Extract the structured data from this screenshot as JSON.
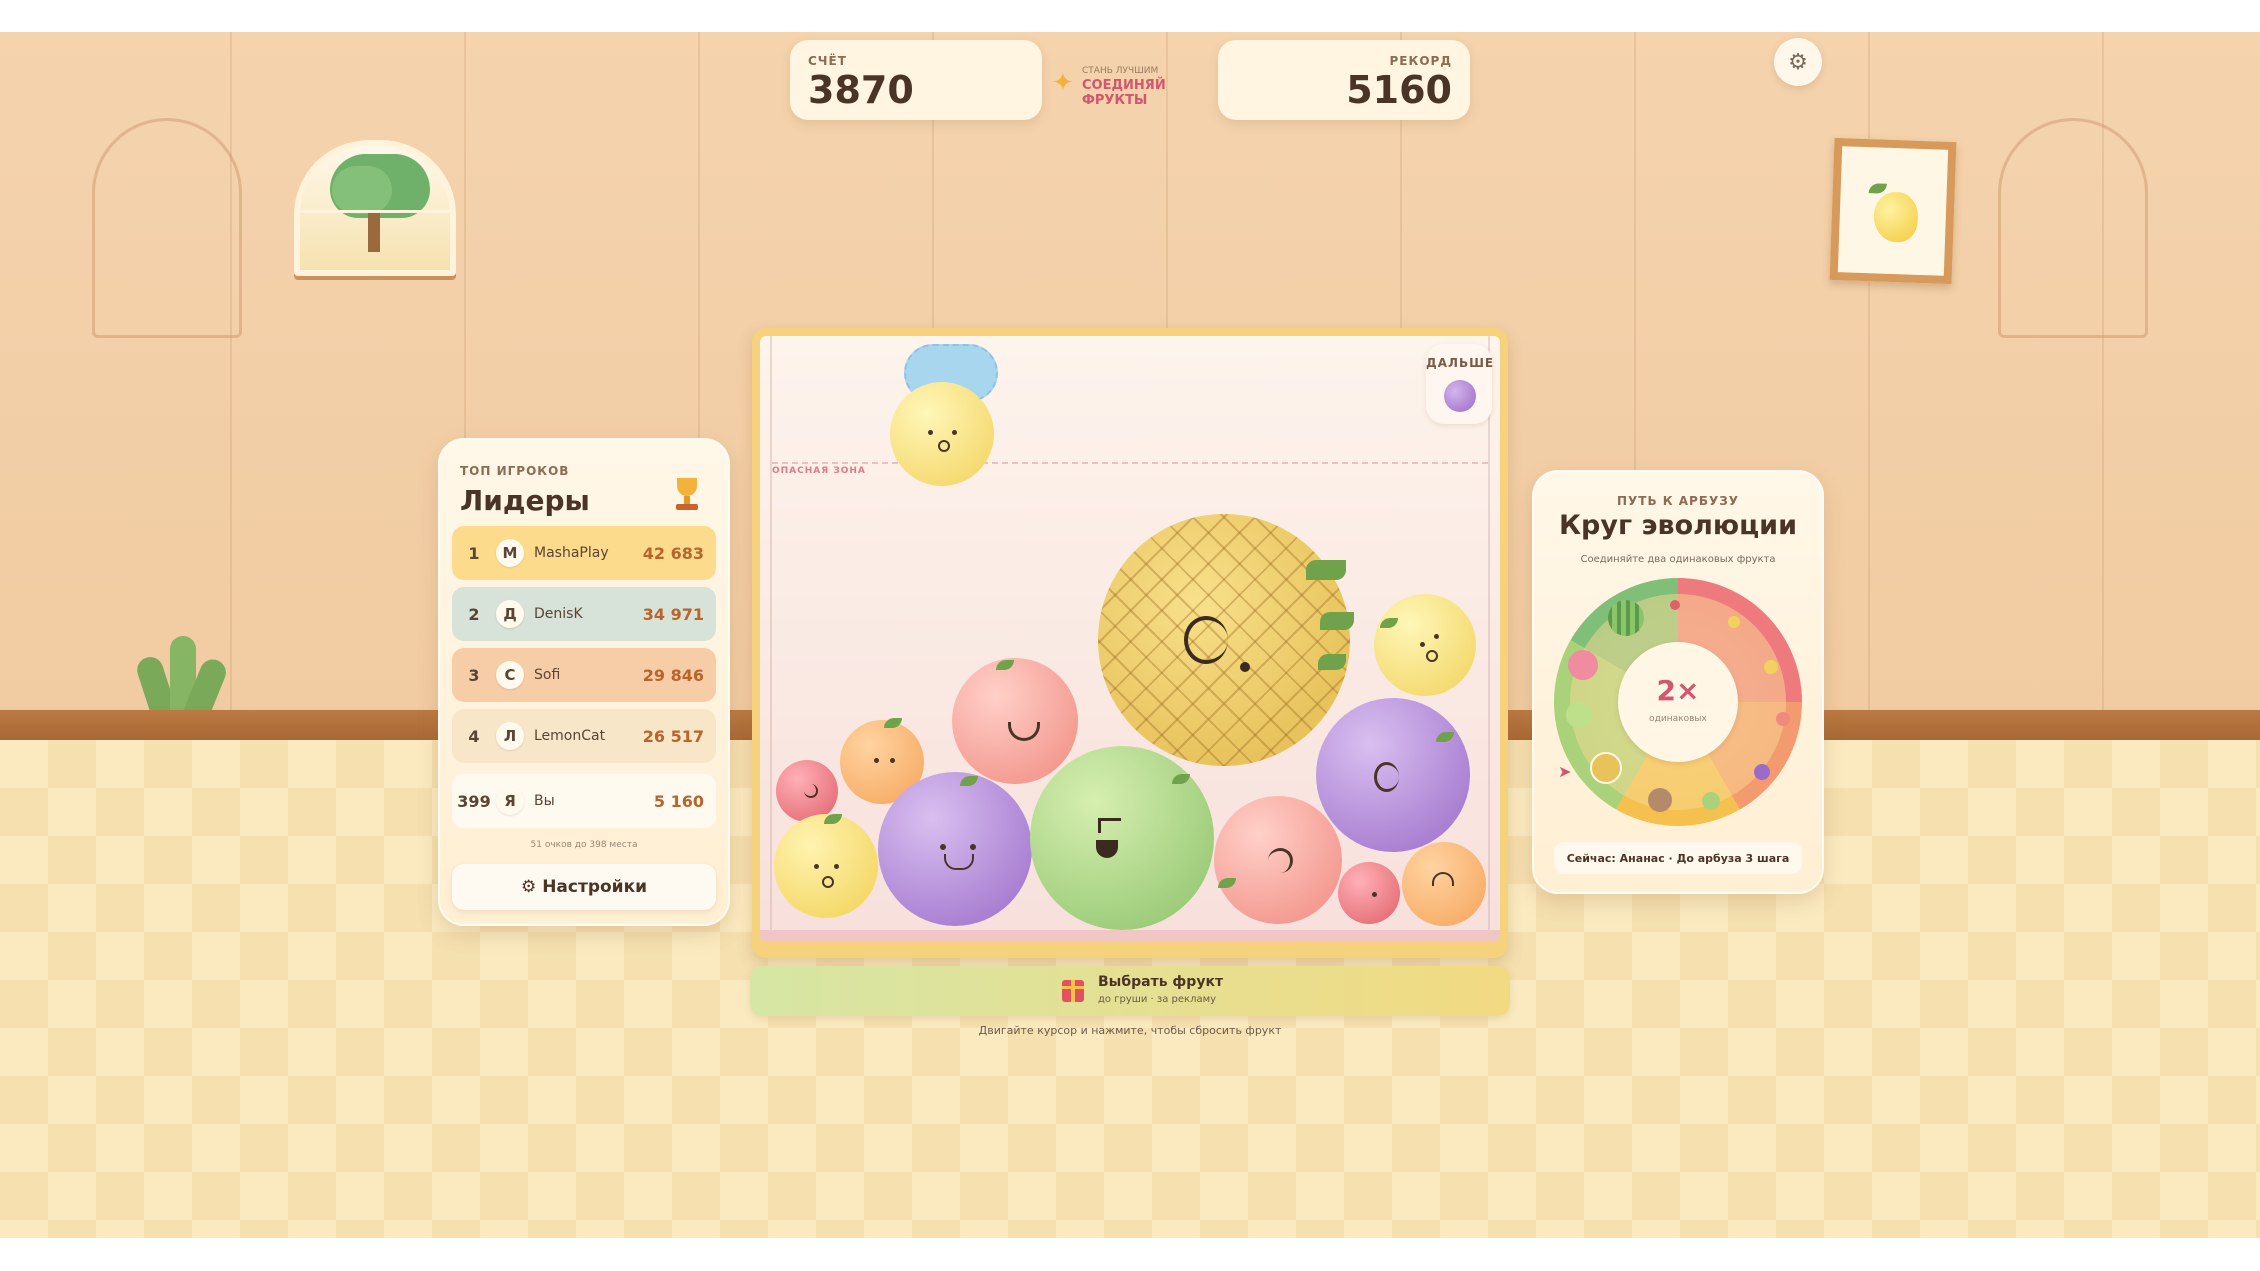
{
  "hud": {
    "score_label": "СЧЁТ",
    "score_value": "3870",
    "slogan_top": "СТАНЬ ЛУЧШИМ",
    "slogan_main": "СОЕДИНЯЙ ФРУКТЫ",
    "record_label": "РЕКОРД",
    "record_value": "5160"
  },
  "leaderboard": {
    "kicker": "ТОП ИГРОКОВ",
    "title": "Лидеры",
    "rows": [
      {
        "rank": "1",
        "avatar": "М",
        "name": "MashaPlay",
        "score": "42 683",
        "color": "#fcdc8c"
      },
      {
        "rank": "2",
        "avatar": "Д",
        "name": "DenisK",
        "score": "34 971",
        "color": "#d7e2d8"
      },
      {
        "rank": "3",
        "avatar": "С",
        "name": "Sofi",
        "score": "29 846",
        "color": "#f7cda8"
      },
      {
        "rank": "4",
        "avatar": "Л",
        "name": "LemonCat",
        "score": "26 517",
        "color": "#f8e6c8"
      },
      {
        "rank": "399",
        "avatar": "Я",
        "name": "Вы",
        "score": "5 160",
        "color": "#fffaf0"
      }
    ],
    "hint": "51 очков до 398 места",
    "settings_label": "Настройки"
  },
  "board": {
    "danger_label": "ОПАСНАЯ ЗОНА",
    "next_label": "ДАЛЬШЕ",
    "pick_title": "Выбрать фрукт",
    "pick_sub": "до груши · за рекламу",
    "instruction": "Двигайте курсор и нажмите, чтобы сбросить фрукт"
  },
  "evolution": {
    "kicker": "ПУТЬ К АРБУЗУ",
    "title": "Круг эволюции",
    "subtitle": "Соединяйте два одинаковых фрукта",
    "center_big": "2×",
    "center_small": "одинаковых",
    "status": "Сейчас: Ананас · До арбуза 3 шага"
  },
  "icons": {
    "settings": "gear-icon",
    "trophy": "trophy-icon",
    "gift": "gift-icon",
    "sparkle": "sparkle-icon"
  },
  "colors": {
    "accent": "#d2566e",
    "score_text": "#b8642a",
    "board_frame": "#f7d27d"
  }
}
